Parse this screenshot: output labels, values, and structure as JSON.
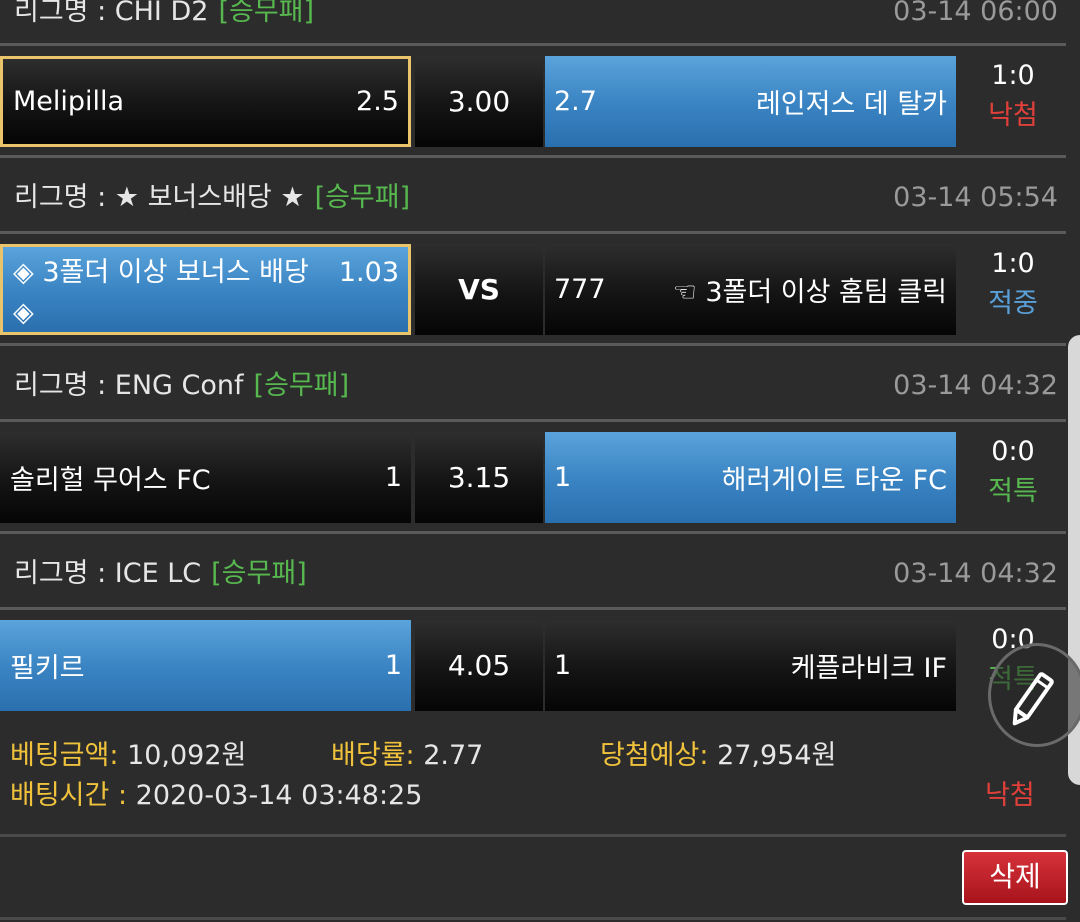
{
  "bets": [
    {
      "league_label": "리그명 : CHI D2",
      "bet_type": "[승무패]",
      "time": "03-14 06:00",
      "home_team": "Melipilla",
      "home_odd": "2.5",
      "middle": "3.00",
      "away_odd": "2.7",
      "away_team": "레인저스 데 탈카",
      "score": "1:0",
      "status": "낙첨",
      "status_color": "#e0403a"
    },
    {
      "league_label": "리그명 : ★ 보너스배당 ★",
      "bet_type": "[승무패]",
      "time": "03-14 05:54",
      "home_team_line1": "◈ 3폴더 이상 보너스 배당",
      "home_team_line2": "◈",
      "home_odd": "1.03",
      "middle": "VS",
      "away_odd": "777",
      "away_team": "☜ 3폴더 이상 홈팀 클릭",
      "score": "1:0",
      "status": "적중",
      "status_color": "#5aa0d8"
    },
    {
      "league_label": "리그명 : ENG Conf",
      "bet_type": "[승무패]",
      "time": "03-14 04:32",
      "home_team": "솔리헐 무어스 FC",
      "home_odd": "1",
      "middle": "3.15",
      "away_odd": "1",
      "away_team": "해러게이트 타운 FC",
      "score": "0:0",
      "status": "적특",
      "status_color": "#57b84f"
    },
    {
      "league_label": "리그명 : ICE LC",
      "bet_type": "[승무패]",
      "time": "03-14 04:32",
      "home_team": "필키르",
      "home_odd": "1",
      "middle": "4.05",
      "away_odd": "1",
      "away_team": "케플라비크 IF",
      "score": "0:0",
      "status": "적특",
      "status_color": "#57b84f"
    }
  ],
  "summary": {
    "amount_label": "베팅금액:",
    "amount_value": "10,092원",
    "rate_label": "배당률:",
    "rate_value": "2.77",
    "expected_label": "당첨예상:",
    "expected_value": "27,954원",
    "time_label": "배팅시간 :",
    "time_value": "2020-03-14 03:48:25",
    "result": "낙첨"
  },
  "delete_label": "삭제",
  "edit_icon": "pencil-icon"
}
